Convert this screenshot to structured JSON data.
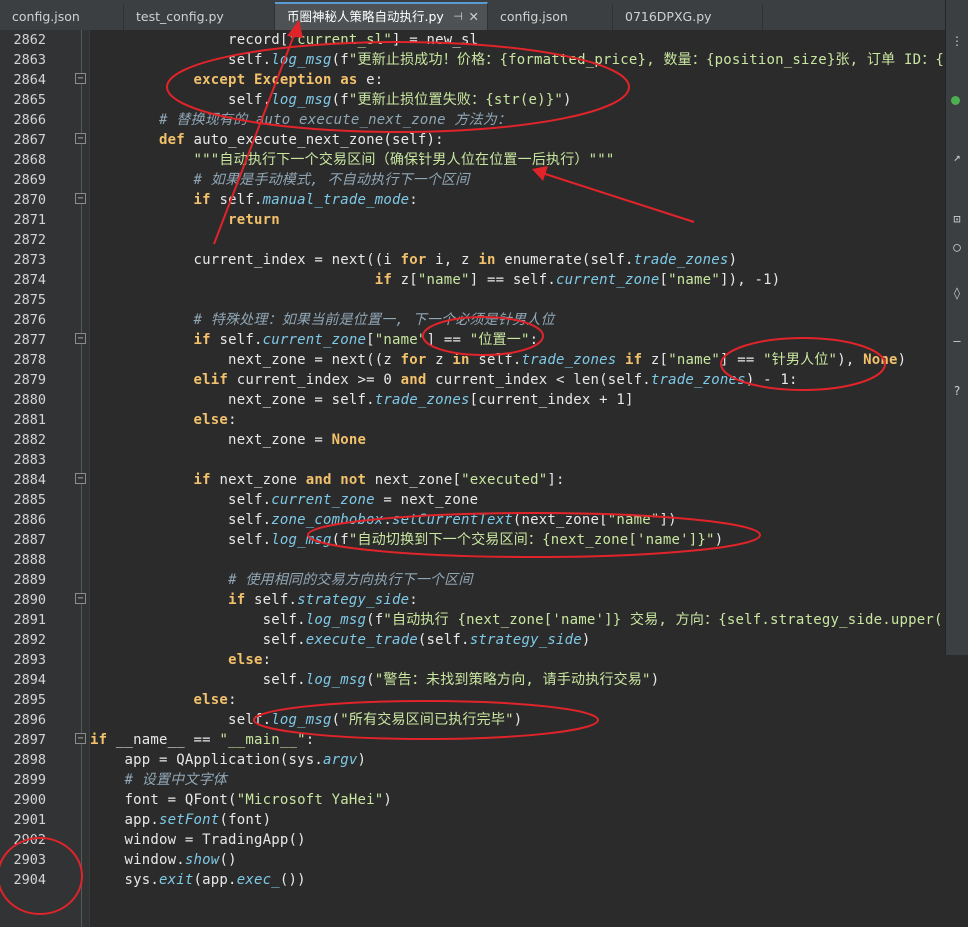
{
  "tabs": [
    {
      "label": "config.json",
      "active": false
    },
    {
      "label": "test_config.py",
      "active": false
    },
    {
      "label": "币圈神秘人策略自动执行.py",
      "active": true
    },
    {
      "label": "config.json",
      "active": false
    },
    {
      "label": "0716DPXG.py",
      "active": false
    }
  ],
  "tab_pin_glyph": "⊣",
  "tab_close_glyph": "✕",
  "side_panel": {
    "icons": [
      "menu-icon",
      "status-dot-icon",
      "arrow-icon",
      "lock-icon",
      "circle-icon",
      "shield-icon",
      "dash-icon",
      "help-icon"
    ]
  },
  "editor": {
    "first_line": 2862,
    "lines": [
      {
        "n": "2862",
        "text": "                record[\"current_sl\"] = new_sl"
      },
      {
        "n": "2863",
        "text": "                self.log_msg(f\"更新止损成功！价格：{formatted_price}, 数量：{position_size}张, 订单 ID：{"
      },
      {
        "n": "2864",
        "text": "            except Exception as e:"
      },
      {
        "n": "2865",
        "text": "                self.log_msg(f\"更新止损位置失败：{str(e)}\")"
      },
      {
        "n": "2866",
        "text": "        # 替换现有的 auto_execute_next_zone 方法为："
      },
      {
        "n": "2867",
        "text": "        def auto_execute_next_zone(self):"
      },
      {
        "n": "2868",
        "text": "            \"\"\"自动执行下一个交易区间（确保针男人位在位置一后执行）\"\"\""
      },
      {
        "n": "2869",
        "text": "            # 如果是手动模式, 不自动执行下一个区间"
      },
      {
        "n": "2870",
        "text": "            if self.manual_trade_mode:"
      },
      {
        "n": "2871",
        "text": "                return"
      },
      {
        "n": "2872",
        "text": ""
      },
      {
        "n": "2873",
        "text": "            current_index = next((i for i, z in enumerate(self.trade_zones)"
      },
      {
        "n": "2874",
        "text": "                                 if z[\"name\"] == self.current_zone[\"name\"]), -1)"
      },
      {
        "n": "2875",
        "text": ""
      },
      {
        "n": "2876",
        "text": "            # 特殊处理：如果当前是位置一, 下一个必须是针男人位"
      },
      {
        "n": "2877",
        "text": "            if self.current_zone[\"name\"] == \"位置一\":"
      },
      {
        "n": "2878",
        "text": "                next_zone = next((z for z in self.trade_zones if z[\"name\"] == \"针男人位\"), None)"
      },
      {
        "n": "2879",
        "text": "            elif current_index >= 0 and current_index < len(self.trade_zones) - 1:"
      },
      {
        "n": "2880",
        "text": "                next_zone = self.trade_zones[current_index + 1]"
      },
      {
        "n": "2881",
        "text": "            else:"
      },
      {
        "n": "2882",
        "text": "                next_zone = None"
      },
      {
        "n": "2883",
        "text": ""
      },
      {
        "n": "2884",
        "text": "            if next_zone and not next_zone[\"executed\"]:"
      },
      {
        "n": "2885",
        "text": "                self.current_zone = next_zone"
      },
      {
        "n": "2886",
        "text": "                self.zone_combobox.setCurrentText(next_zone[\"name\"])"
      },
      {
        "n": "2887",
        "text": "                self.log_msg(f\"自动切换到下一个交易区间：{next_zone['name']}\")"
      },
      {
        "n": "2888",
        "text": ""
      },
      {
        "n": "2889",
        "text": "                # 使用相同的交易方向执行下一个区间"
      },
      {
        "n": "2890",
        "text": "                if self.strategy_side:"
      },
      {
        "n": "2891",
        "text": "                    self.log_msg(f\"自动执行 {next_zone['name']} 交易, 方向：{self.strategy_side.upper()"
      },
      {
        "n": "2892",
        "text": "                    self.execute_trade(self.strategy_side)"
      },
      {
        "n": "2893",
        "text": "                else:"
      },
      {
        "n": "2894",
        "text": "                    self.log_msg(\"警告：未找到策略方向, 请手动执行交易\")"
      },
      {
        "n": "2895",
        "text": "            else:"
      },
      {
        "n": "2896",
        "text": "                self.log_msg(\"所有交易区间已执行完毕\")"
      },
      {
        "n": "2897",
        "text": "if __name__ == \"__main__\":"
      },
      {
        "n": "2898",
        "text": "    app = QApplication(sys.argv)"
      },
      {
        "n": "2899",
        "text": "    # 设置中文字体"
      },
      {
        "n": "2900",
        "text": "    font = QFont(\"Microsoft YaHei\")"
      },
      {
        "n": "2901",
        "text": "    app.setFont(font)"
      },
      {
        "n": "2902",
        "text": "    window = TradingApp()"
      },
      {
        "n": "2903",
        "text": "    window.show()"
      },
      {
        "n": "2904",
        "text": "    sys.exit(app.exec_())"
      }
    ]
  },
  "colors": {
    "background": "#2b2b2b",
    "keyword": "#f2c16b",
    "string": "#c8e6a0",
    "comment": "#8fa6b5",
    "method": "#7ec9e6",
    "annotation": "#e0242a"
  }
}
